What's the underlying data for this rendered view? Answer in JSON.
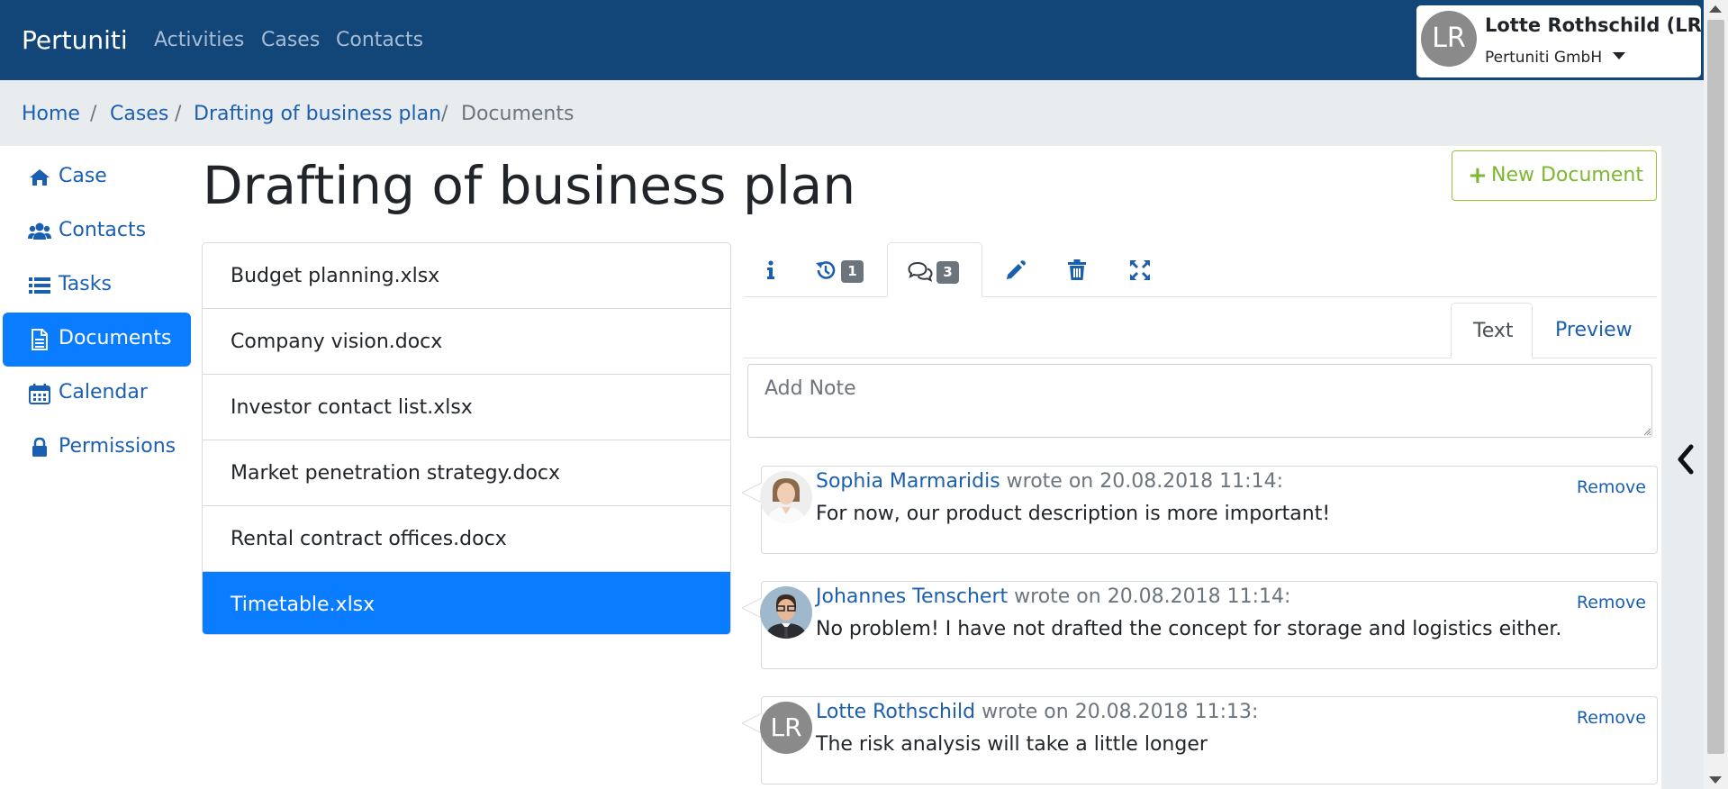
{
  "app": {
    "brand": "Pertuniti"
  },
  "nav": {
    "items": [
      {
        "label": "Activities"
      },
      {
        "label": "Cases"
      },
      {
        "label": "Contacts"
      }
    ]
  },
  "user": {
    "initials": "LR",
    "name": "Lotte Rothschild (LR)",
    "org": "Pertuniti GmbH"
  },
  "breadcrumb": [
    {
      "label": "Home"
    },
    {
      "label": "Cases"
    },
    {
      "label": "Drafting of business plan"
    },
    {
      "label": "Documents"
    }
  ],
  "sidebar": {
    "items": [
      {
        "label": "Case",
        "icon": "home-icon"
      },
      {
        "label": "Contacts",
        "icon": "users-icon"
      },
      {
        "label": "Tasks",
        "icon": "list-icon"
      },
      {
        "label": "Documents",
        "icon": "document-icon",
        "active": true
      },
      {
        "label": "Calendar",
        "icon": "calendar-icon"
      },
      {
        "label": "Permissions",
        "icon": "lock-icon"
      }
    ]
  },
  "page": {
    "title": "Drafting of business plan",
    "new_document_label": "New Document"
  },
  "documents": [
    {
      "name": "Budget planning.xlsx"
    },
    {
      "name": "Company vision.docx"
    },
    {
      "name": "Investor contact list.xlsx"
    },
    {
      "name": "Market penetration strategy.docx"
    },
    {
      "name": "Rental contract offices.docx"
    },
    {
      "name": "Timetable.xlsx",
      "selected": true
    }
  ],
  "detail_tabs": {
    "items": [
      {
        "icon": "info-icon"
      },
      {
        "icon": "history-icon",
        "badge": "1"
      },
      {
        "icon": "comments-icon",
        "badge": "3",
        "active": true
      },
      {
        "icon": "pencil-icon"
      },
      {
        "icon": "trash-icon"
      },
      {
        "icon": "expand-icon"
      }
    ]
  },
  "note_editor": {
    "tabs": [
      {
        "label": "Text",
        "active": true
      },
      {
        "label": "Preview"
      }
    ],
    "placeholder": "Add Note"
  },
  "comments": [
    {
      "author": "Sophia Marmaridis",
      "meta": " wrote on 20.08.2018 11:14:",
      "text": "For now, our product description is more important!",
      "remove_label": "Remove",
      "avatar": "photo"
    },
    {
      "author": "Johannes Tenschert",
      "meta": " wrote on 20.08.2018 11:14:",
      "text": "No problem! I have not drafted the concept for storage and logistics either.",
      "remove_label": "Remove",
      "avatar": "photo"
    },
    {
      "author": "Lotte Rothschild",
      "meta": " wrote on 20.08.2018 11:13:",
      "text": "The risk analysis will take a little longer",
      "remove_label": "Remove",
      "avatar": "LR"
    }
  ],
  "colors": {
    "navbar": "#134678",
    "link": "#1b5fb0",
    "active": "#0a7cff",
    "success": "#7cb82f"
  }
}
